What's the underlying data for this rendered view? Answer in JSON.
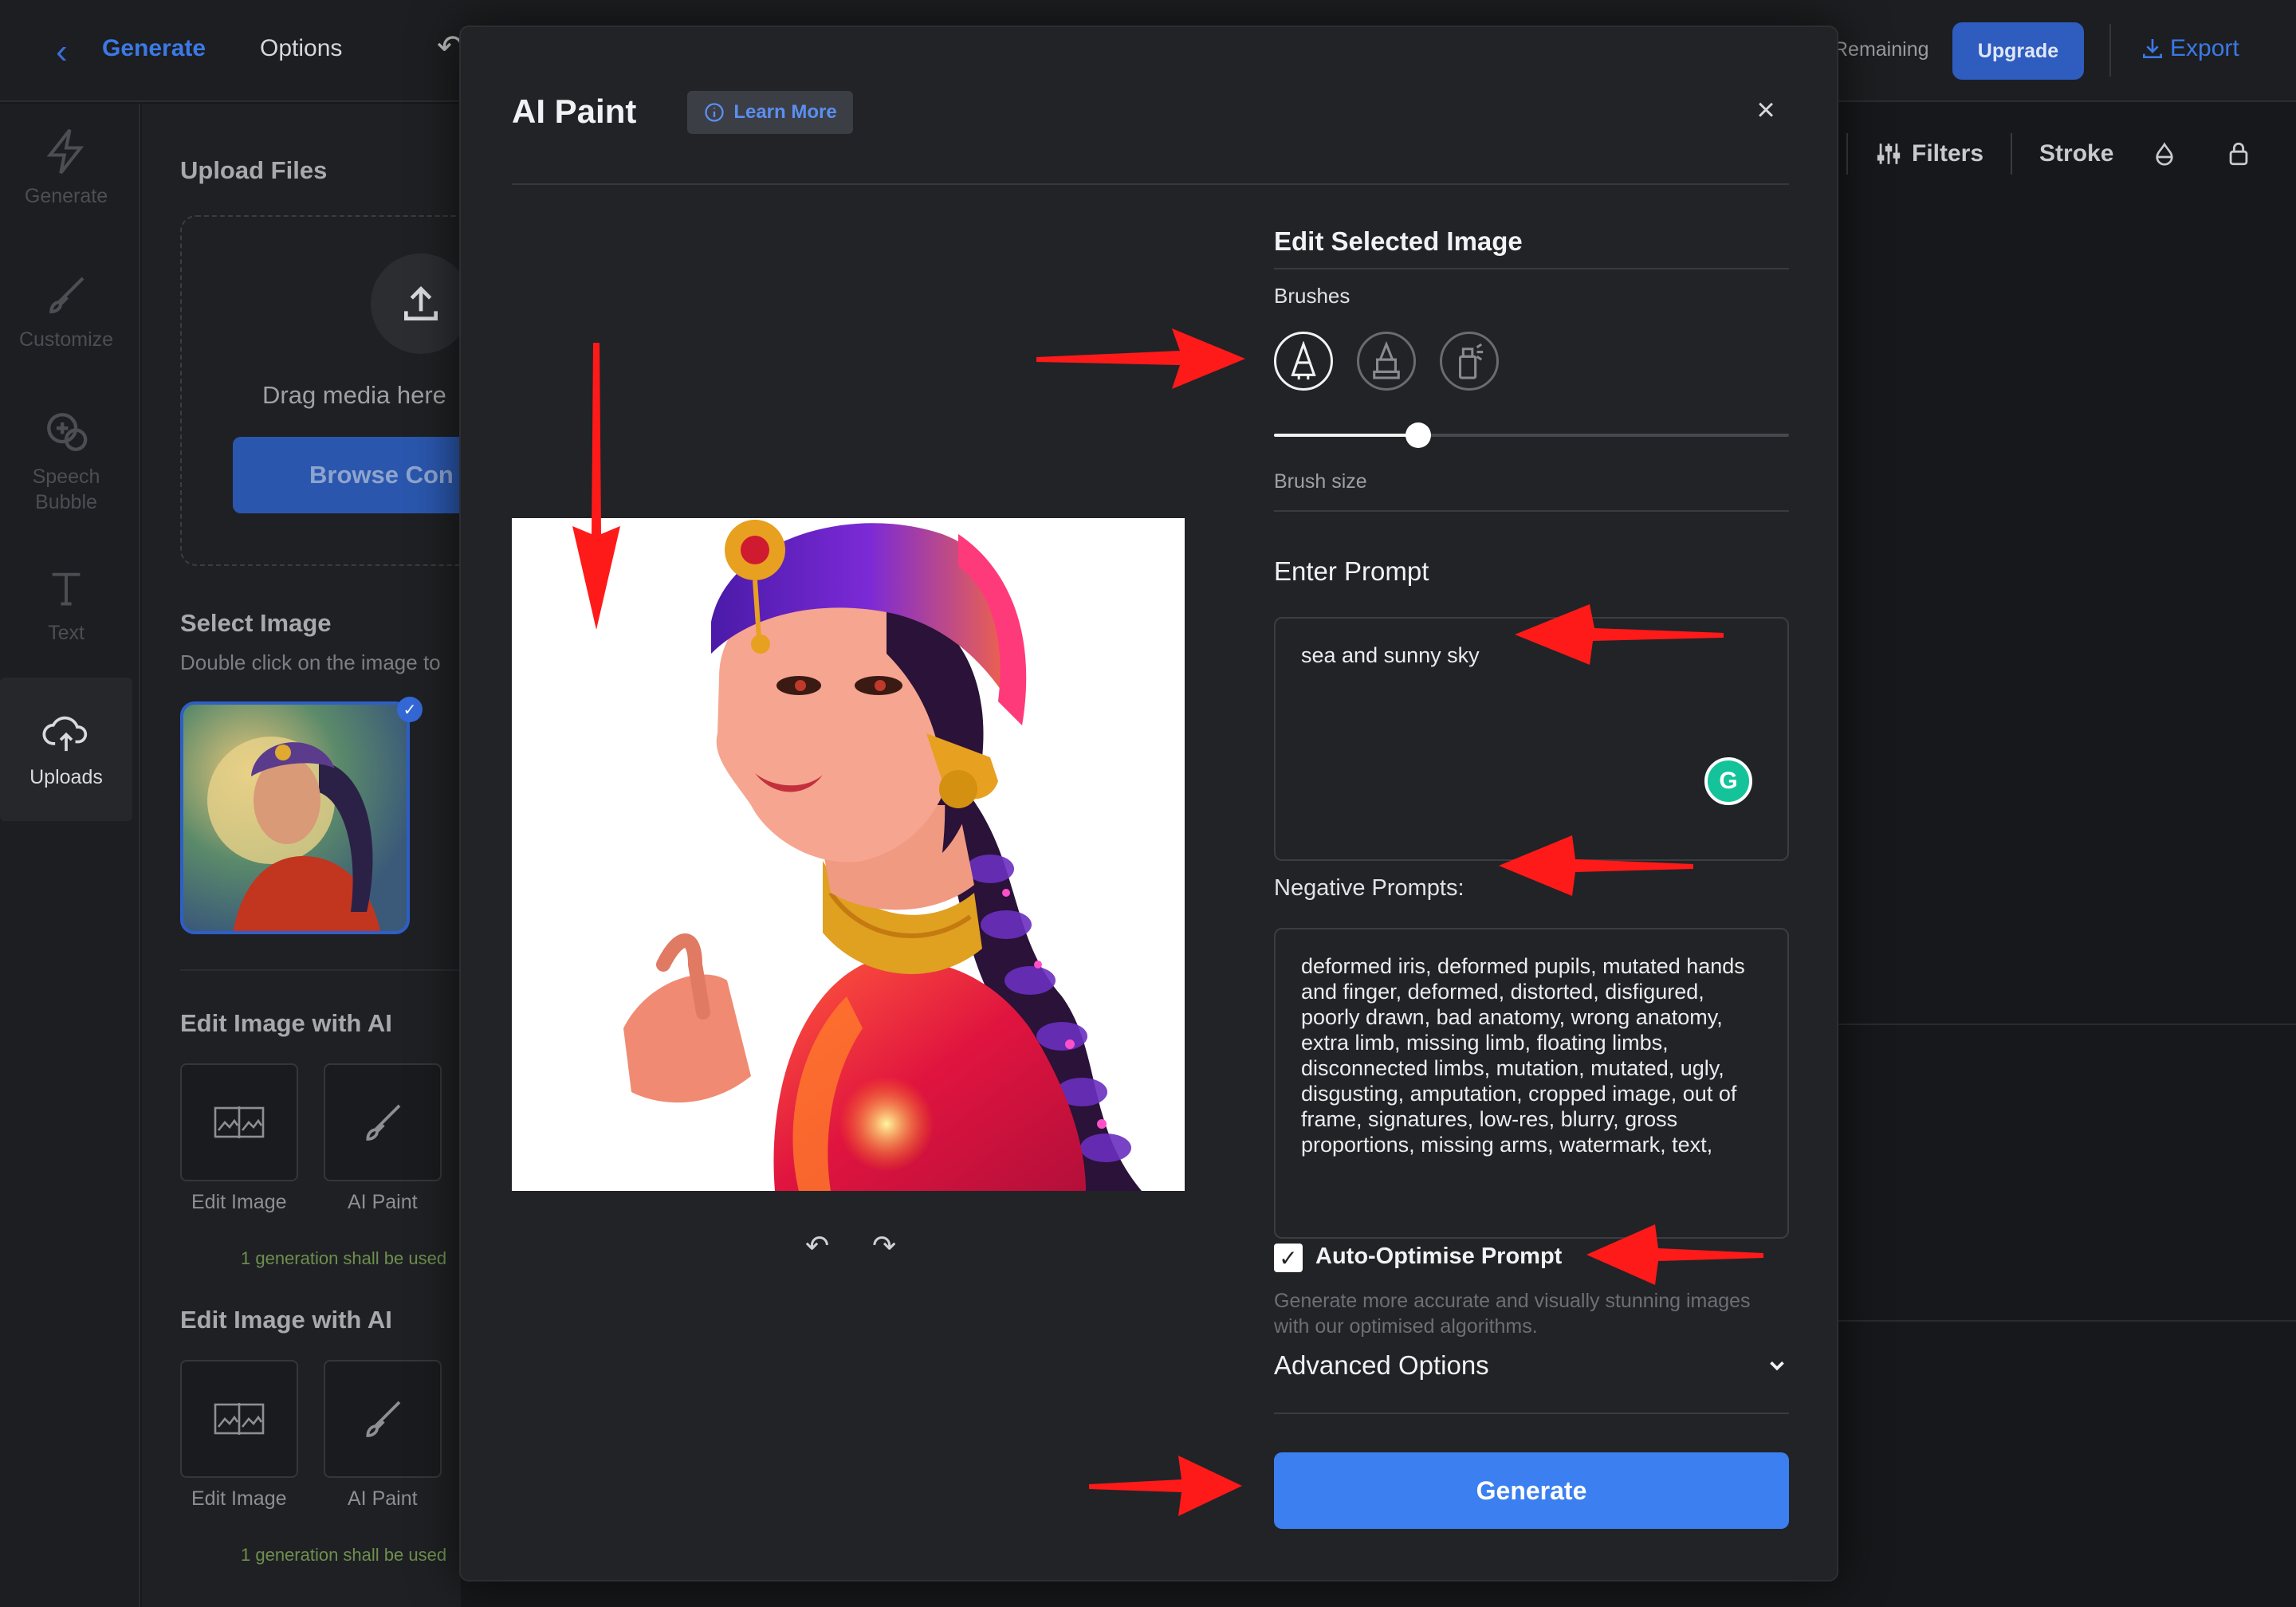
{
  "topbar": {
    "back_label": "Generate",
    "options_label": "Options",
    "remaining_label": "Remaining",
    "upgrade_label": "Upgrade",
    "export_label": "Export"
  },
  "toolstrip": {
    "filters_label": "Filters",
    "stroke_label": "Stroke"
  },
  "rail": {
    "items": [
      {
        "label": "Generate",
        "icon": "lightning-icon"
      },
      {
        "label": "Customize",
        "icon": "brush-icon"
      },
      {
        "label": "Speech Bubble",
        "icon": "speech-bubble-icon"
      },
      {
        "label": "Text",
        "icon": "text-icon"
      },
      {
        "label": "Uploads",
        "icon": "cloud-upload-icon"
      }
    ]
  },
  "panel": {
    "upload_title": "Upload Files",
    "drag_text": "Drag media here",
    "browse_label": "Browse Con",
    "select_title": "Select Image",
    "select_sub": "Double click on the image to",
    "edit_sections": [
      {
        "title": "Edit Image with AI",
        "tools": [
          "Edit Image",
          "AI Paint"
        ],
        "note": "1 generation shall be used"
      },
      {
        "title": "Edit Image with AI",
        "tools": [
          "Edit Image",
          "AI Paint"
        ],
        "note": "1 generation shall be used"
      }
    ]
  },
  "modal": {
    "title": "AI Paint",
    "learn_more": "Learn More",
    "close_glyph": "×",
    "edit_heading": "Edit Selected Image",
    "brushes_label": "Brushes",
    "brush_size_label": "Brush size",
    "brush_size_value": 0.28,
    "prompt_heading": "Enter Prompt",
    "prompt_value": "sea and sunny sky",
    "negative_label": "Negative Prompts:",
    "negative_value": "deformed iris, deformed pupils, mutated hands and finger, deformed, distorted, disfigured, poorly drawn, bad anatomy, wrong anatomy, extra limb, missing limb, floating limbs, disconnected limbs, mutation, mutated, ugly, disgusting, amputation, cropped image, out of frame, signatures, low-res, blurry, gross proportions, missing arms, watermark, text,",
    "auto_optimise_label": "Auto-Optimise Prompt",
    "auto_optimise_checked": true,
    "auto_optimise_help": "Generate more accurate and visually stunning images with our optimised algorithms.",
    "advanced_label": "Advanced Options",
    "generate_label": "Generate"
  },
  "colors": {
    "accent": "#3b7ff0",
    "annotation_arrow": "#ff1a1a"
  }
}
